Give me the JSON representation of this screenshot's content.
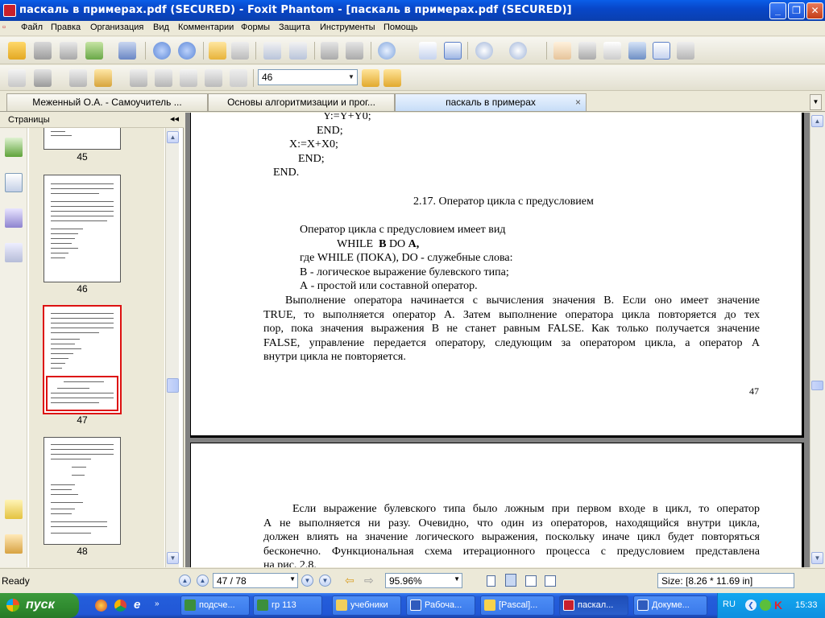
{
  "window": {
    "title": "паскаль в примерах.pdf (SECURED) - Foxit Phantom - [паскаль в примерах.pdf (SECURED)]"
  },
  "menu": [
    "Файл",
    "Правка",
    "Организация",
    "Вид",
    "Комментарии",
    "Формы",
    "Защита",
    "Инструменты",
    "Помощь"
  ],
  "toolbar": {
    "page_input": "46"
  },
  "tabs": [
    {
      "label": "Меженный О.А. - Самоучитель ..."
    },
    {
      "label": "Основы алгоритмизации и прог..."
    },
    {
      "label": "паскаль в примерах",
      "active": true
    }
  ],
  "sidebar": {
    "title": "Страницы",
    "thumbnails": [
      {
        "page": "45"
      },
      {
        "page": "46"
      },
      {
        "page": "47",
        "selected": true
      },
      {
        "page": "48"
      }
    ]
  },
  "document": {
    "page1": {
      "code": [
        "Y:=Y+Y0;",
        "END;",
        "X:=X+X0;",
        "END;",
        "END."
      ],
      "heading": "2.17. Оператор цикла с предусловием",
      "intro": "Оператор цикла с предусловием имеет вид",
      "syntax_1": "WHILE",
      "syntax_2": "B",
      "syntax_3": "DO",
      "syntax_4": "A,",
      "where": "где WHILE (ПОКА), DO - служебные слова:",
      "b_def": "В - логическое выражение булевского типа;",
      "a_def": "А - простой или составной оператор.",
      "para_lines": [
        "Выполнение оператора начинается с вычисления значения В. Если оно имеет значение",
        "TRUE, то выполняется оператор А. Затем выполнение оператора цикла повторяется до тех",
        "пор, пока значения выражения В не станет равным FALSE. Как только получается значение",
        "FALSE, управление передается оператору, следующим за оператором цикла, а оператор А",
        "внутри цикла не повторяется."
      ],
      "page_number": "47"
    },
    "page2": {
      "para_lines": [
        "Если выражение булевского типа было ложным при первом входе в цикл, то оператор",
        "А не выполняется ни разу. Очевидно, что один из операторов, находящийся внутри цикла,",
        "должен влиять на значение логического выражения, поскольку иначе цикл будет повторяться",
        "бесконечно. Функциональная схема итерационного процесса с предусловием представлена",
        "на рис. 2.8."
      ]
    }
  },
  "status": {
    "ready": "Ready",
    "page_field": "47 / 78",
    "zoom": "95.96%",
    "size": "Size: [8.26 * 11.69 in]"
  },
  "taskbar": {
    "start": "пуск",
    "items": [
      "подсче...",
      "гр 113",
      "учебники",
      "Рабоча...",
      "[Pascal]...",
      "паскал...",
      "Докуме..."
    ],
    "active_index": 5,
    "lang": "RU",
    "clock": "15:33"
  },
  "colors": {
    "title_bar": "#0a4fd6",
    "selection": "#dd1111",
    "taskbar": "#245edb",
    "start": "#2f8a2f"
  }
}
